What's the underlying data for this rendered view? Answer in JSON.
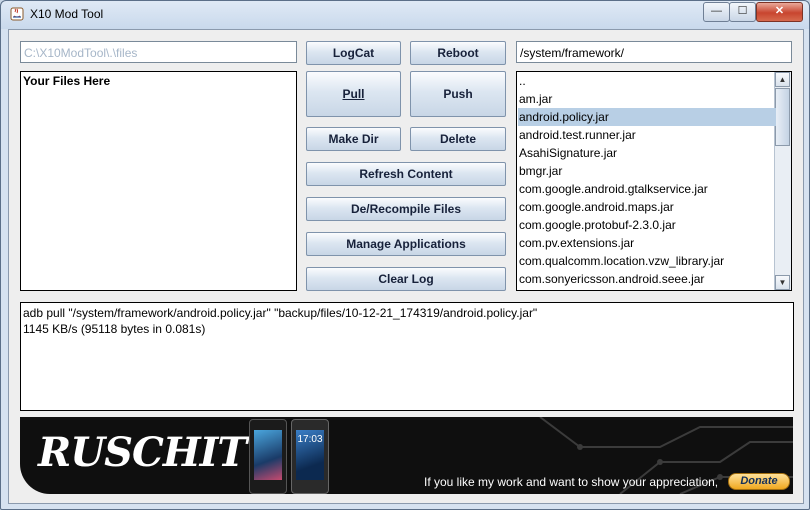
{
  "window": {
    "title": "X10 Mod Tool",
    "controls": {
      "minimize": "—",
      "maximize": "☐",
      "close": "✕"
    }
  },
  "left_path": {
    "value": "C:\\X10ModTool\\.\\files"
  },
  "right_path": {
    "value": "/system/framework/"
  },
  "files_panel": {
    "label": "Your Files Here"
  },
  "buttons": {
    "logcat": "LogCat",
    "reboot": "Reboot",
    "pull": "Pull",
    "push": "Push",
    "make_dir": "Make Dir",
    "delete": "Delete",
    "refresh": "Refresh Content",
    "recompile": "De/Recompile Files",
    "manage_apps": "Manage Applications",
    "clear_log": "Clear Log"
  },
  "file_list": {
    "items": [
      {
        "label": "..",
        "selected": false
      },
      {
        "label": "am.jar",
        "selected": false
      },
      {
        "label": "android.policy.jar",
        "selected": true
      },
      {
        "label": "android.test.runner.jar",
        "selected": false
      },
      {
        "label": "AsahiSignature.jar",
        "selected": false
      },
      {
        "label": "bmgr.jar",
        "selected": false
      },
      {
        "label": "com.google.android.gtalkservice.jar",
        "selected": false
      },
      {
        "label": "com.google.android.maps.jar",
        "selected": false
      },
      {
        "label": "com.google.protobuf-2.3.0.jar",
        "selected": false
      },
      {
        "label": "com.pv.extensions.jar",
        "selected": false
      },
      {
        "label": "com.qualcomm.location.vzw_library.jar",
        "selected": false
      },
      {
        "label": "com.sonyericsson.android.seee.jar",
        "selected": false
      }
    ]
  },
  "log": {
    "lines": [
      "adb pull \"/system/framework/android.policy.jar\" \"backup/files/10-12-21_174319/android.policy.jar\"",
      "1145 KB/s (95118 bytes in 0.081s)"
    ]
  },
  "banner": {
    "logo_text": "RUSCHIT",
    "phone_clock": "17:03",
    "appreciation": "If you like my work and want to show your appreciation,",
    "donate": "Donate"
  }
}
